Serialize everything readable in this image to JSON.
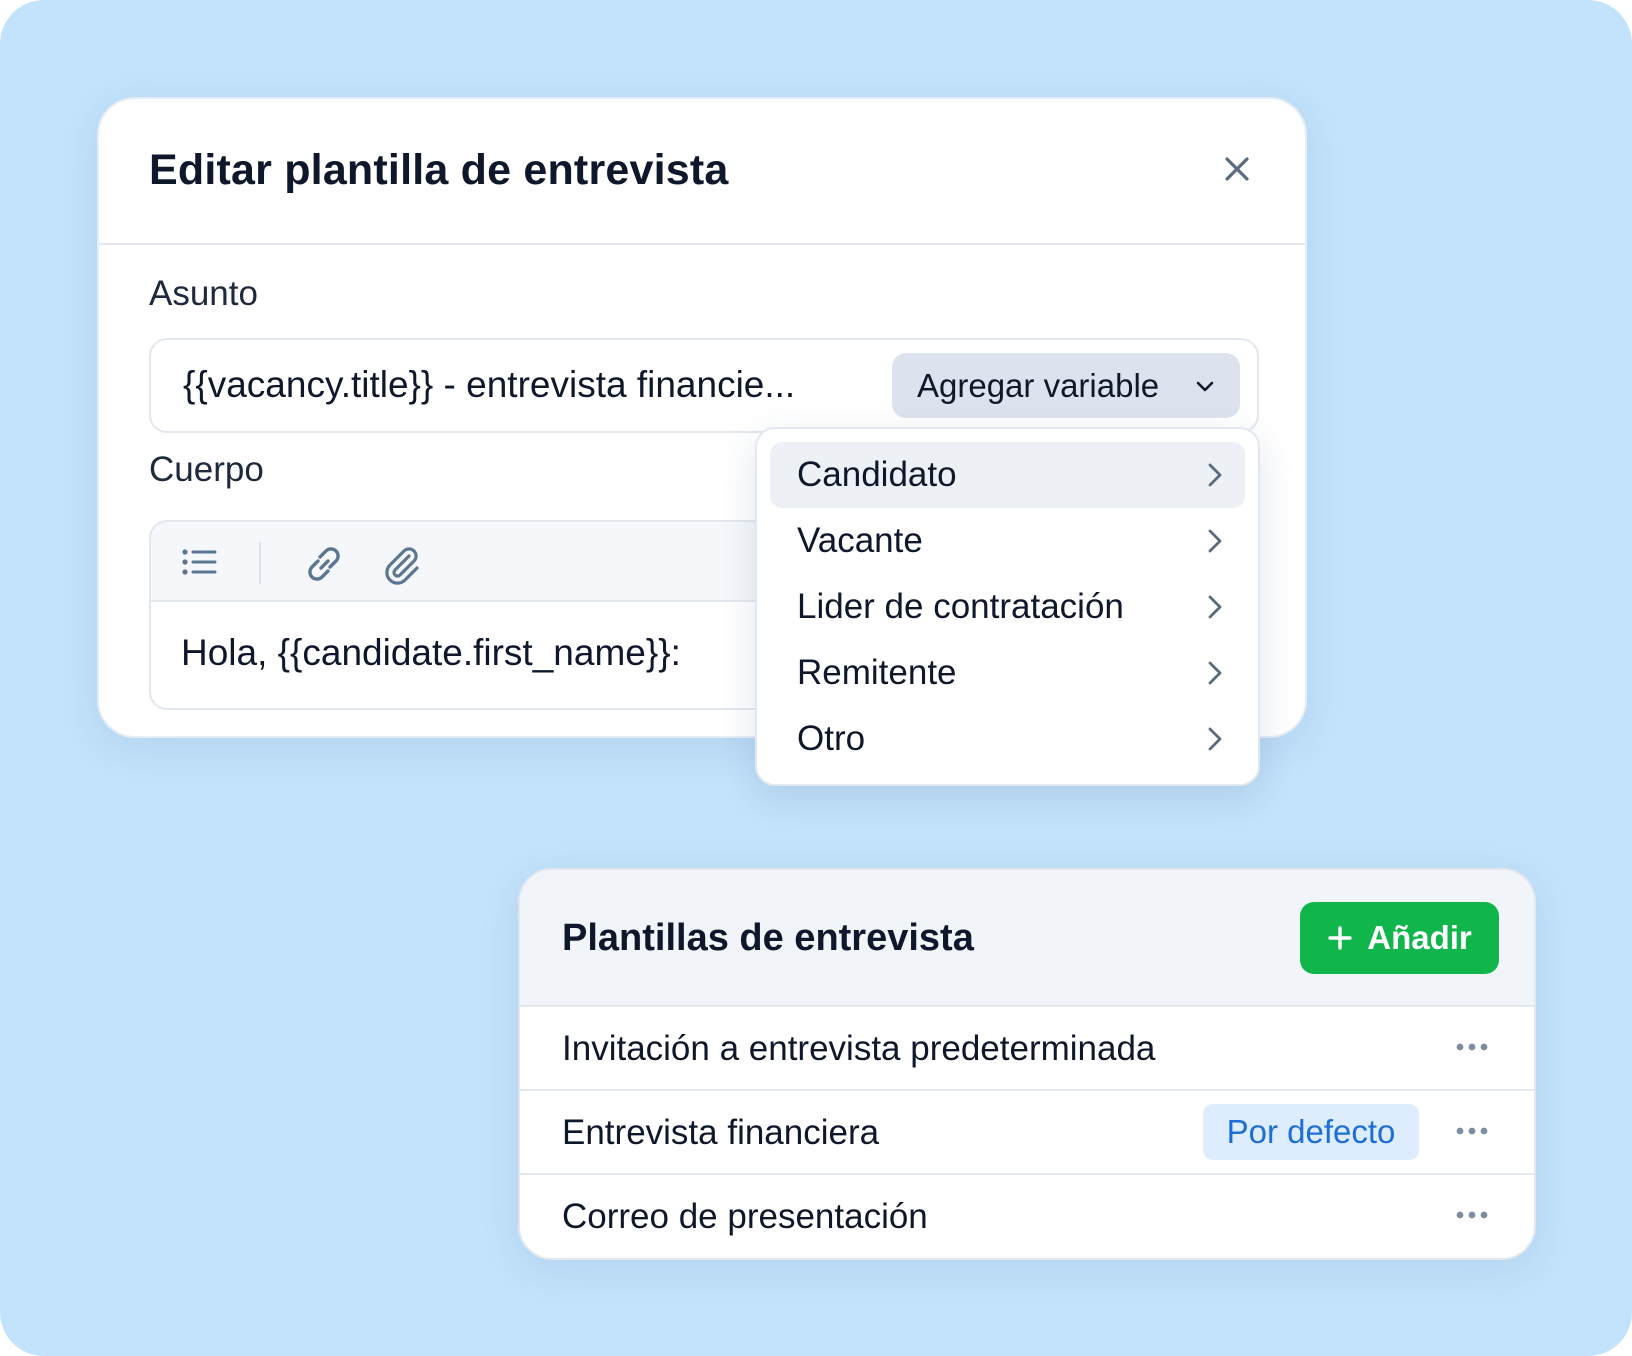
{
  "modal": {
    "title": "Editar plantilla de entrevista",
    "subject_label": "Asunto",
    "subject_value": "{{vacancy.title}} - entrevista financie...",
    "add_variable_label": "Agregar variable",
    "body_label": "Cuerpo",
    "body_text": "Hola, {{candidate.first_name}}:",
    "toolbar_icons": [
      "list-icon",
      "link-icon",
      "paperclip-icon"
    ]
  },
  "dropdown": {
    "items": [
      {
        "label": "Candidato",
        "active": true
      },
      {
        "label": "Vacante"
      },
      {
        "label": "Lider de contratación"
      },
      {
        "label": "Remitente"
      },
      {
        "label": "Otro"
      }
    ]
  },
  "templates": {
    "title": "Plantillas de entrevista",
    "add_label": "Añadir",
    "rows": [
      {
        "label": "Invitación a entrevista predeterminada"
      },
      {
        "label": "Entrevista financiera",
        "badge": "Por defecto"
      },
      {
        "label": "Correo de presentación"
      }
    ]
  },
  "colors": {
    "background": "#c3e2fb",
    "accent_green": "#10b54b",
    "badge_bg": "#deedfd",
    "badge_text": "#1d6fd6"
  }
}
